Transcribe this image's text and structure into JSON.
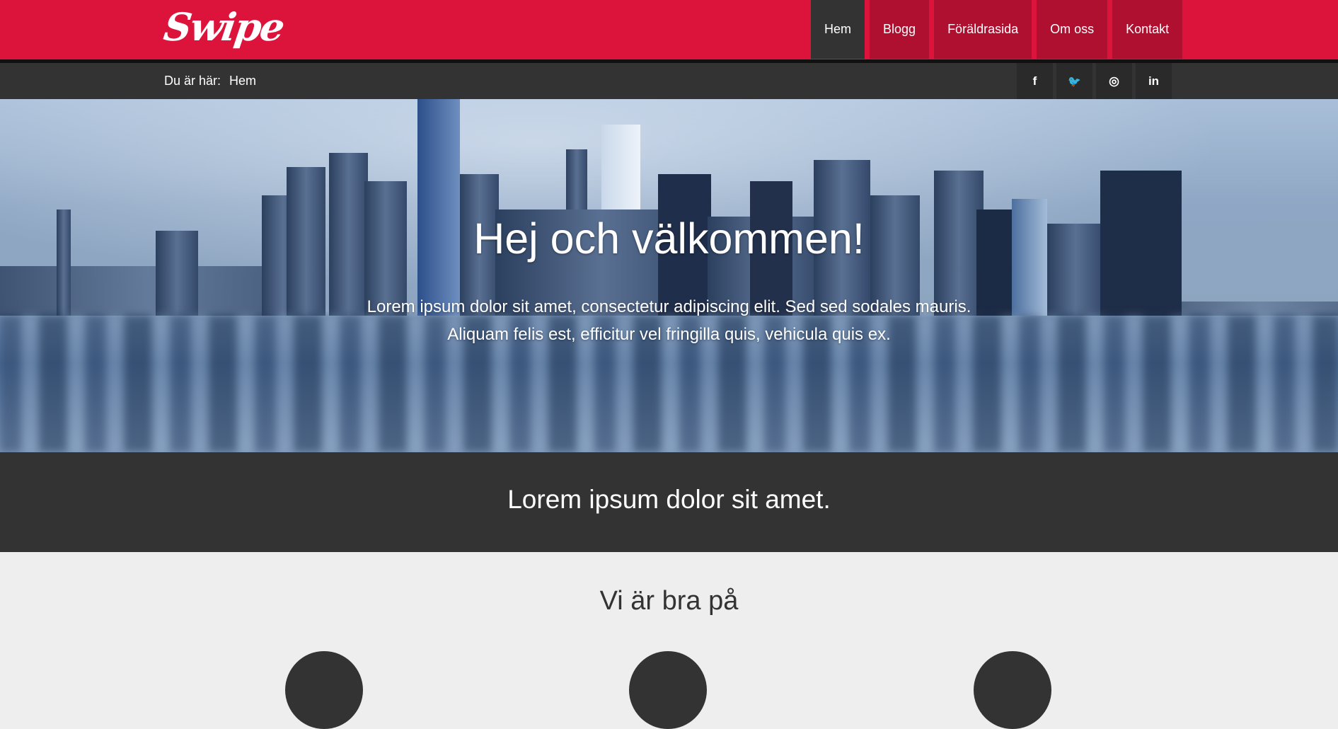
{
  "header": {
    "logo": "Swipe",
    "nav": [
      {
        "label": "Hem",
        "active": true
      },
      {
        "label": "Blogg"
      },
      {
        "label": "Föräldrasida"
      },
      {
        "label": "Om oss"
      },
      {
        "label": "Kontakt"
      }
    ]
  },
  "breadcrumb": {
    "prefix": "Du är här:",
    "current": "Hem"
  },
  "social": [
    {
      "icon": "facebook-icon",
      "glyph": "f"
    },
    {
      "icon": "twitter-icon",
      "glyph": "🐦"
    },
    {
      "icon": "instagram-icon",
      "glyph": "◎"
    },
    {
      "icon": "linkedin-icon",
      "glyph": "in"
    }
  ],
  "hero": {
    "title": "Hej och välkommen!",
    "subtitle": "Lorem ipsum dolor sit amet, consectetur adipiscing elit. Sed sed sodales mauris. Aliquam felis est, efficitur vel fringilla quis, vehicula quis ex."
  },
  "band": {
    "text": "Lorem ipsum dolor sit amet."
  },
  "skills": {
    "title": "Vi är bra på"
  },
  "colors": {
    "brand": "#dc133b",
    "nav_item": "#b01030",
    "dark": "#333333",
    "light": "#eeeeee"
  }
}
